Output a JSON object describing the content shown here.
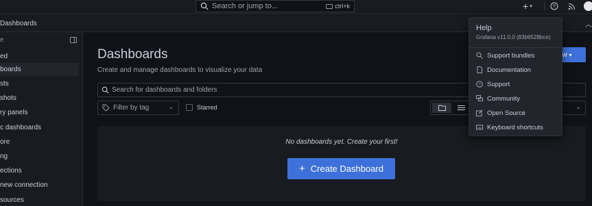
{
  "topbar": {
    "search_placeholder": "Search or jump to...",
    "shortcut": "ctrl+k",
    "plus_label": "+"
  },
  "breadcrumb": {
    "label": "Dashboards"
  },
  "sidebar": {
    "top_label": "e",
    "items": [
      {
        "label": "ed"
      },
      {
        "label": "boards"
      },
      {
        "label": "sts"
      },
      {
        "label": "shots"
      },
      {
        "label": "ry panels"
      },
      {
        "label": "c dashboards"
      },
      {
        "label": "ore"
      },
      {
        "label": "ng"
      },
      {
        "label": "ections"
      },
      {
        "label": "new connection"
      },
      {
        "label": "sources"
      }
    ],
    "active_index": 1
  },
  "main": {
    "title": "Dashboards",
    "subtitle": "Create and manage dashboards to visualize your data",
    "new_button": "ew",
    "search_placeholder": "Search for dashboards and folders",
    "filter_label": "Filter by tag",
    "starred_label": "Starred",
    "empty_text": "No dashboards yet. Create your first!",
    "create_button": "Create Dashboard"
  },
  "help_menu": {
    "title": "Help",
    "version": "Grafana v11.0.0 (83b9528bce)",
    "items": [
      {
        "label": "Support bundles",
        "icon": "support-bundles-icon"
      },
      {
        "label": "Documentation",
        "icon": "document-icon"
      },
      {
        "label": "Support",
        "icon": "question-icon"
      },
      {
        "label": "Community",
        "icon": "comments-icon"
      },
      {
        "label": "Open Source",
        "icon": "external-link-icon"
      },
      {
        "label": "Keyboard shortcuts",
        "icon": "keyboard-icon"
      }
    ]
  },
  "colors": {
    "background": "#111217",
    "panel": "#181b1f",
    "primary": "#3d71d9",
    "text": "#ccccdc"
  }
}
